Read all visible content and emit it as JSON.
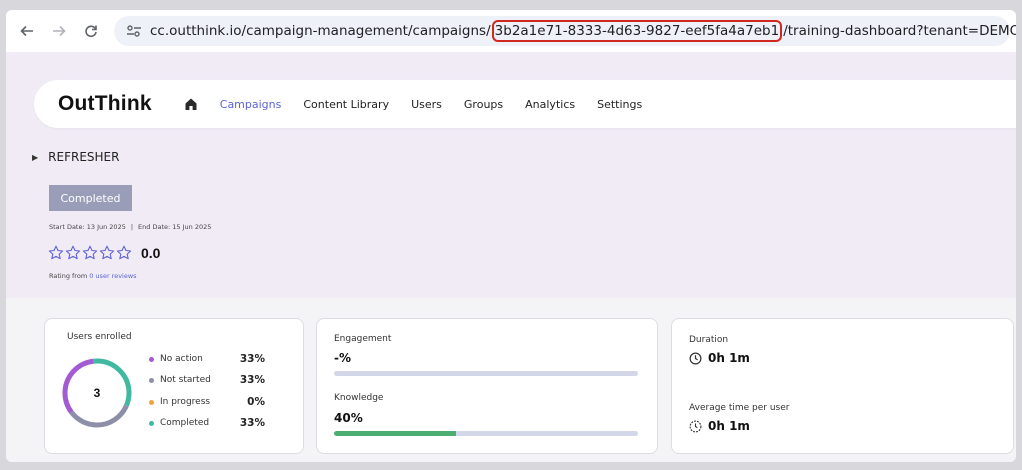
{
  "browser": {
    "url_host": "cc.outthink.io",
    "url_path_before": "/campaign-management/campaigns/",
    "url_highlight": "3b2a1e71-8333-4d63-9827-eef5fa4a7eb1",
    "url_path_after": "/training-dashboard?tenant=DEMO",
    "highlight_color": "#d0281f"
  },
  "app": {
    "logo": "OutThink",
    "nav": [
      {
        "label": "Campaigns",
        "active": true
      },
      {
        "label": "Content Library",
        "active": false
      },
      {
        "label": "Users",
        "active": false
      },
      {
        "label": "Groups",
        "active": false
      },
      {
        "label": "Analytics",
        "active": false
      },
      {
        "label": "Settings",
        "active": false
      }
    ],
    "accent": "#5b63d6"
  },
  "campaign": {
    "title": "REFRESHER",
    "status": "Completed",
    "start_date": "Start Date: 13 Jun 2025",
    "separator": "|",
    "end_date": "End Date: 15 Jun 2025",
    "rating": "0.0",
    "stars_filled": 0,
    "stars_total": 5,
    "rating_prefix": "Rating from",
    "rating_link": "0 user reviews"
  },
  "enrolled": {
    "label": "Users enrolled",
    "count": "3",
    "legend": [
      {
        "label": "No action",
        "pct": "33%",
        "color": "#a35bd3",
        "fraction": 0.3333
      },
      {
        "label": "Not started",
        "pct": "33%",
        "color": "#8d8fa8",
        "fraction": 0.3333
      },
      {
        "label": "In progress",
        "pct": "0%",
        "color": "#f2a33c",
        "fraction": 0.0
      },
      {
        "label": "Completed",
        "pct": "33%",
        "color": "#41b9a0",
        "fraction": 0.3333
      }
    ]
  },
  "engagement": {
    "label": "Engagement",
    "value": "-%",
    "fraction": 0
  },
  "knowledge": {
    "label": "Knowledge",
    "value": "40%",
    "fraction": 0.4
  },
  "duration": {
    "label": "Duration",
    "value": "0h 1m",
    "avg_label": "Average time per user",
    "avg_value": "0h 1m"
  }
}
